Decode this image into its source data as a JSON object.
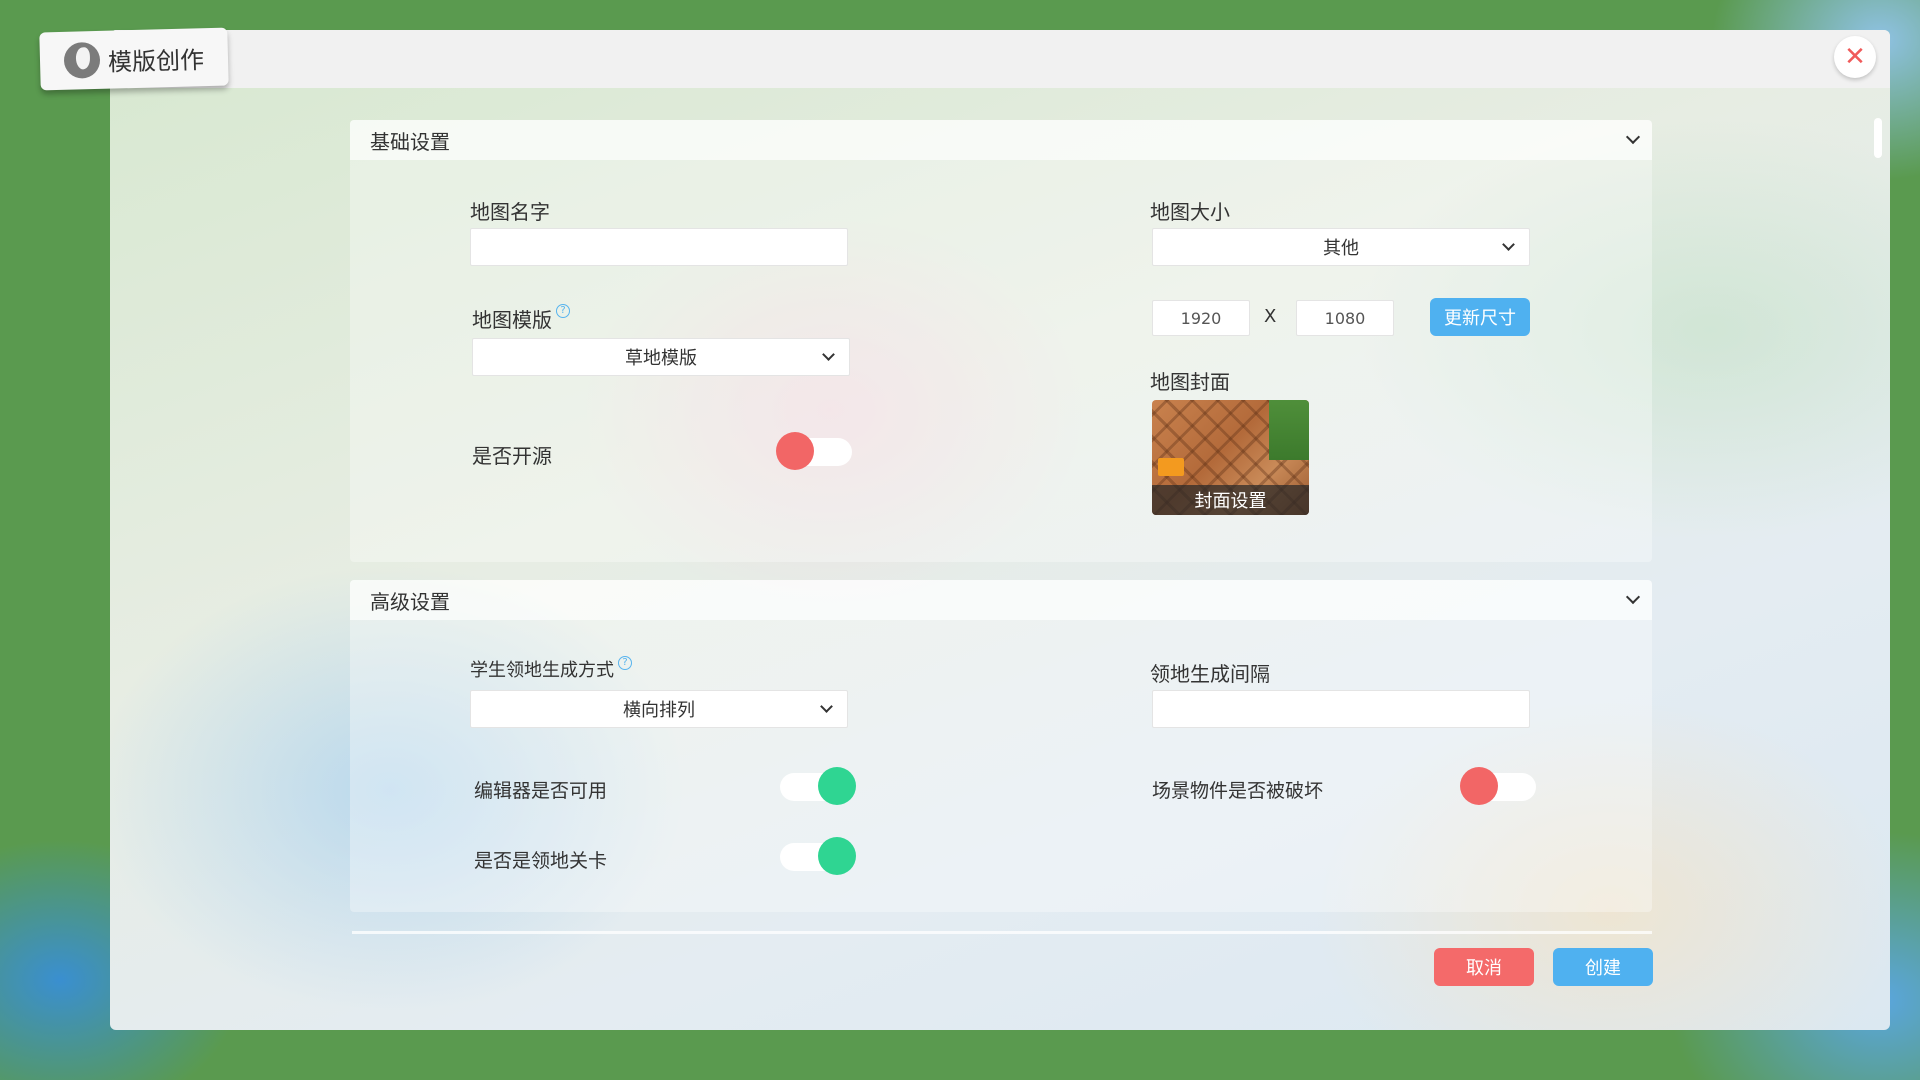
{
  "window": {
    "title": "模版创作",
    "close_icon": "✕"
  },
  "basic": {
    "title": "基础设置",
    "map_name": {
      "label": "地图名字",
      "value": ""
    },
    "map_template": {
      "label": "地图模版",
      "help": "?",
      "value": "草地模版"
    },
    "open_source": {
      "label": "是否开源",
      "state": "off"
    },
    "map_size": {
      "label": "地图大小",
      "value": "其他",
      "width": "1920",
      "separator": "X",
      "height": "1080",
      "update_label": "更新尺寸"
    },
    "map_cover": {
      "label": "地图封面",
      "action_label": "封面设置"
    }
  },
  "advanced": {
    "title": "高级设置",
    "territory_mode": {
      "label": "学生领地生成方式",
      "help": "?",
      "value": "横向排列"
    },
    "territory_interval": {
      "label": "领地生成间隔",
      "value": ""
    },
    "editor_enabled": {
      "label": "编辑器是否可用",
      "state": "on"
    },
    "is_territory_level": {
      "label": "是否是领地关卡",
      "state": "on"
    },
    "object_destructible": {
      "label": "场景物件是否被破坏",
      "state": "off"
    }
  },
  "footer": {
    "cancel_label": "取消",
    "create_label": "创建"
  },
  "colors": {
    "primary_blue": "#4fb1f0",
    "danger_red": "#f46a6a",
    "toggle_on": "#2fd592",
    "toggle_off": "#f26666",
    "text": "#333333"
  }
}
